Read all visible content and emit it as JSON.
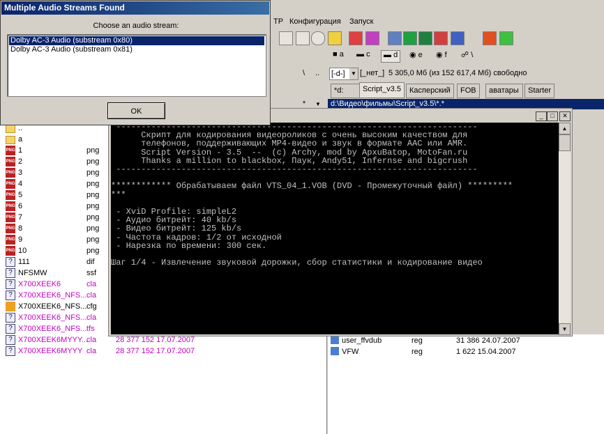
{
  "menu": {
    "item0": "TP",
    "item1": "Конфигурация",
    "item2": "Запуск"
  },
  "drives": [
    {
      "label": "a"
    },
    {
      "label": "c"
    },
    {
      "label": "d"
    },
    {
      "label": "e"
    },
    {
      "label": "f"
    },
    {
      "label": "\\"
    }
  ],
  "path_info": {
    "backslash": "\\",
    "updir": "..",
    "drive_select": "[-d-]",
    "volume": "[_нет_]",
    "free_text": "5 305,0 Мб (из 152 617,4 Мб) свободно"
  },
  "tabs": [
    "*d:",
    "Script_v3.5",
    "Касперский",
    "FOB",
    "аватары",
    "Starter"
  ],
  "current_path": "d:\\Видео\\фильмы\\Script_v3.5\\*.*",
  "left_panel": {
    "star": "*",
    "files": [
      {
        "name": "..",
        "ext": "",
        "size": "",
        "icon": "folder-up"
      },
      {
        "name": "a",
        "ext": "",
        "size": "",
        "icon": "folder"
      },
      {
        "name": "1",
        "ext": "png",
        "size": "",
        "icon": "png"
      },
      {
        "name": "2",
        "ext": "png",
        "size": "",
        "icon": "png"
      },
      {
        "name": "3",
        "ext": "png",
        "size": "",
        "icon": "png"
      },
      {
        "name": "4",
        "ext": "png",
        "size": "",
        "icon": "png"
      },
      {
        "name": "5",
        "ext": "png",
        "size": "",
        "icon": "png"
      },
      {
        "name": "6",
        "ext": "png",
        "size": "",
        "icon": "png"
      },
      {
        "name": "7",
        "ext": "png",
        "size": "",
        "icon": "png"
      },
      {
        "name": "8",
        "ext": "png",
        "size": "",
        "icon": "png"
      },
      {
        "name": "9",
        "ext": "png",
        "size": "",
        "icon": "png"
      },
      {
        "name": "10",
        "ext": "png",
        "size": "",
        "icon": "png"
      },
      {
        "name": "111",
        "ext": "dif",
        "size": "",
        "icon": "doc"
      },
      {
        "name": "NFSMW",
        "ext": "ssf",
        "size": "",
        "icon": "unknown"
      },
      {
        "name": "X700XEEK6",
        "ext": "cla",
        "size": "",
        "icon": "unknown",
        "purple": true
      },
      {
        "name": "X700XEEK6_NFS...",
        "ext": "cla",
        "size": "",
        "icon": "unknown",
        "purple": true
      },
      {
        "name": "X700XEEK6_NFS...",
        "ext": "cfg",
        "size": "",
        "icon": "cfg",
        "purple": false
      },
      {
        "name": "X700XEEK6_NFS...",
        "ext": "cla",
        "size": "",
        "icon": "unknown",
        "purple": true
      },
      {
        "name": "X700XEEK6_NFS...",
        "ext": "tfs",
        "size": "",
        "icon": "unknown",
        "purple": true
      },
      {
        "name": "X700XEEK6MYYY...",
        "ext": "cla",
        "size": "28 377 152 17.07.2007",
        "icon": "unknown",
        "purple": true
      },
      {
        "name": "X700XEEK6MYYY",
        "ext": "cla",
        "size": "28 377 152 17.07.2007",
        "icon": "unknown",
        "purple": true
      }
    ]
  },
  "right_panel": {
    "files": [
      {
        "name": "user_ffvdub",
        "ext": "reg",
        "size": "31 386 24.07.2007"
      },
      {
        "name": "VFW",
        "ext": "reg",
        "size": "1 622 15.04.2007"
      }
    ]
  },
  "dialog": {
    "title": "Multiple Audio Streams Found",
    "prompt": "Choose an audio stream:",
    "streams": [
      "Dolby AC-3 Audio (substream 0x80)",
      "Dolby AC-3 Audio (substream 0x81)"
    ],
    "ok_label": "OK"
  },
  "console": {
    "text": " ------------------------------------------------------------------------\n      Скрипт для кодирования видеороликов с очень высоким качеством для\n      телефонов, поддерживающих MP4-видео и звук в формате AAC или AMR.\n      Script Version - 3.5  --  (c) Archy, mod by ApxuBatop, MotoFan.ru\n      Thanks a million to blackbox, Паук, Andy51, Infernse and bigcrush\n ------------------------------------------------------------------------\n\n************ Обрабатываем файл VTS_04_1.VOB (DVD - Промежуточный файл) *********\n***\n\n - XviD Profile: simpleL2\n - Аудио битрейт: 40 kb/s\n - Видео битрейт: 125 kb/s\n - Частота кадров: 1/2 от исходной\n - Нарезка по времени: 300 сек.\n\nШаг 1/4 - Извлечение звуковой дорожки, сбор статистики и кодирование видео"
  },
  "colors": {
    "title_bar": "#0a246a",
    "selection": "#0a246a",
    "console_bg": "#000000",
    "console_fg": "#c0c0c0",
    "purple_file": "#c000c0"
  }
}
